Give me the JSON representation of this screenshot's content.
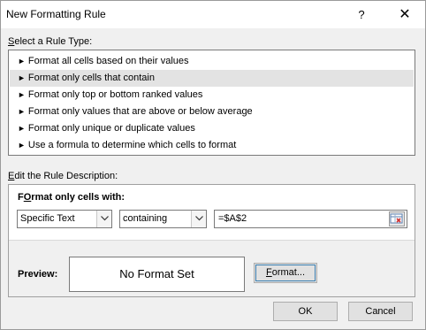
{
  "dialog": {
    "title": "New Formatting Rule",
    "help_label": "?",
    "close_label": "✕"
  },
  "rule_type": {
    "label_access": "S",
    "label_rest": "elect a Rule Type:",
    "items": [
      {
        "label": "Format all cells based on their values",
        "selected": false
      },
      {
        "label": "Format only cells that contain",
        "selected": true
      },
      {
        "label": "Format only top or bottom ranked values",
        "selected": false
      },
      {
        "label": "Format only values that are above or below average",
        "selected": false
      },
      {
        "label": "Format only unique or duplicate values",
        "selected": false
      },
      {
        "label": "Use a formula to determine which cells to format",
        "selected": false
      }
    ],
    "arrow": "►"
  },
  "description": {
    "label_access": "E",
    "label_rest": "dit the Rule Description:",
    "format_title_access": "O",
    "format_title_pre": "F",
    "format_title_rest": "rmat only cells with:",
    "condition_type": "Specific Text",
    "operator": "containing",
    "value": "=$A$2",
    "preview_label": "Preview:",
    "preview_text": "No Format Set",
    "format_button_access": "F",
    "format_button_rest": "ormat..."
  },
  "buttons": {
    "ok": "OK",
    "cancel": "Cancel"
  },
  "colors": {
    "dialog_bg": "#f0f0f0",
    "selected_row": "#e3e3e3",
    "focus_border": "#3c7fb1"
  }
}
